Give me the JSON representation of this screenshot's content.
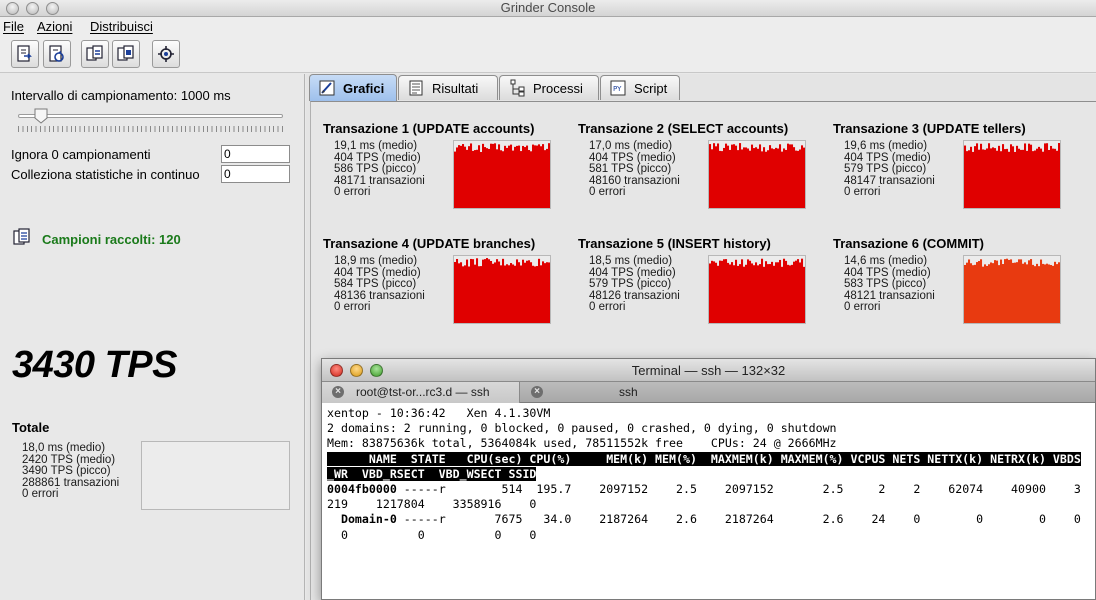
{
  "window": {
    "title": "Grinder Console"
  },
  "menu": {
    "file": "File",
    "azioni": "Azioni",
    "distribuisci": "Distribuisci"
  },
  "left": {
    "interval_label": "Intervallo di campionamento: 1000 ms",
    "interval_fraction": 0.07,
    "ignore_label": "Ignora 0 campionamenti",
    "ignore_value": "0",
    "collect_label": "Colleziona statistiche in continuo",
    "collect_value": "0",
    "samples_label": "Campioni raccolti: 120",
    "big_tps": "3430 TPS",
    "totale_label": "Totale",
    "totale_stats": [
      "18,0 ms (medio)",
      "2420 TPS (medio)",
      "3490 TPS (picco)",
      "288861 transazioni",
      "0 errori"
    ]
  },
  "tabs": [
    "Grafici",
    "Risultati",
    "Processi",
    "Script"
  ],
  "colors": {
    "bar_red": "#e00000",
    "bar_orange_red": "#e83a10",
    "tab_active": "#9ec0ec"
  },
  "transactions": [
    {
      "title": "Transazione 1 (UPDATE accounts)",
      "stats": [
        "19,1 ms (medio)",
        "404 TPS (medio)",
        "586 TPS (picco)",
        "48171 transazioni",
        "0 errori"
      ],
      "color": "#e00000"
    },
    {
      "title": "Transazione 2 (SELECT accounts)",
      "stats": [
        "17,0 ms (medio)",
        "404 TPS (medio)",
        "581 TPS (picco)",
        "48160 transazioni",
        "0 errori"
      ],
      "color": "#e00000"
    },
    {
      "title": "Transazione 3 (UPDATE tellers)",
      "stats": [
        "19,6 ms (medio)",
        "404 TPS (medio)",
        "579 TPS (picco)",
        "48147 transazioni",
        "0 errori"
      ],
      "color": "#e00000"
    },
    {
      "title": "Transazione 4 (UPDATE branches)",
      "stats": [
        "18,9 ms (medio)",
        "404 TPS (medio)",
        "584 TPS (picco)",
        "48136 transazioni",
        "0 errori"
      ],
      "color": "#e00000"
    },
    {
      "title": "Transazione 5 (INSERT history)",
      "stats": [
        "18,5 ms (medio)",
        "404 TPS (medio)",
        "579 TPS (picco)",
        "48126 transazioni",
        "0 errori"
      ],
      "color": "#e00000"
    },
    {
      "title": "Transazione 6 (COMMIT)",
      "stats": [
        "14,6 ms (medio)",
        "404 TPS (medio)",
        "583 TPS (picco)",
        "48121 transazioni",
        "0 errori"
      ],
      "color": "#e83a10"
    }
  ],
  "terminal": {
    "title": "Terminal — ssh — 132×32",
    "tab1": "root@tst-or...rc3.d — ssh",
    "tab2": "ssh",
    "line1": "xentop - 10:36:42   Xen 4.1.30VM",
    "line2": "2 domains: 2 running, 0 blocked, 0 paused, 0 crashed, 0 dying, 0 shutdown",
    "line3": "Mem: 83875636k total, 5364084k used, 78511552k free    CPUs: 24 @ 2666MHz",
    "header1": "      NAME  STATE   CPU(sec) CPU(%)     MEM(k) MEM(%)  MAXMEM(k) MAXMEM(%) VCPUS NETS NETTX(k) NETRX(k) VBDS",
    "header2": "_WR  VBD_RSECT  VBD_WSECT SSID",
    "row1_name": "0004fb0000",
    "row1_rest": " -----r        514  195.7    2097152    2.5    2097152       2.5     2    2    62074    40900    3",
    "row1_cont": "219    1217804    3358916    0",
    "row2_name": "  Domain-0",
    "row2_rest": " -----r       7675   34.0    2187264    2.6    2187264       2.6    24    0        0        0    0",
    "row2_cont": "  0          0          0    0"
  }
}
